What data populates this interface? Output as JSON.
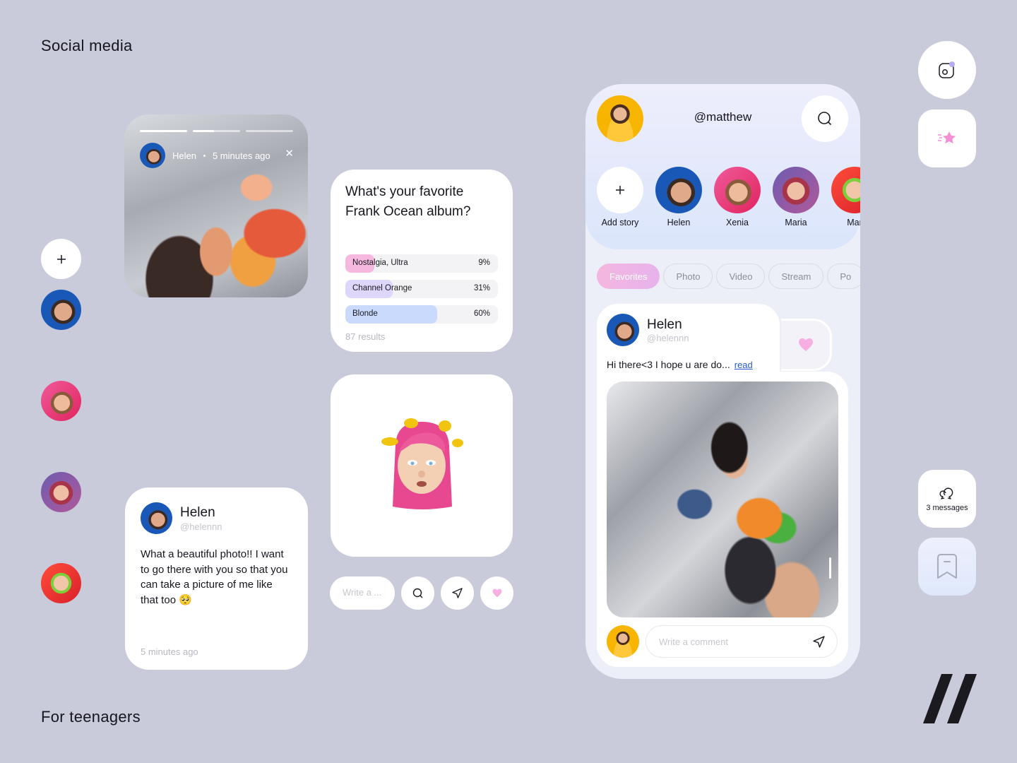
{
  "page": {
    "title": "Social media",
    "subtitle": "For teenagers"
  },
  "colors": {
    "background": "#c9cbdb",
    "accent_pink": "#f7aee0",
    "accent_lilac": "#ded6fb",
    "accent_blue": "#c9dafc",
    "link_blue": "#2a5bd0",
    "notification_dot": "#b9aaf5"
  },
  "story": {
    "user": "Helen",
    "time": "5 minutes ago",
    "segments": [
      {
        "progress": 1.0
      },
      {
        "progress": 0.45
      },
      {
        "progress": 0
      }
    ],
    "close_icon": "close-icon"
  },
  "poll": {
    "question": "What's your favorite Frank Ocean album?",
    "options": [
      {
        "label": "Nostalgia, Ultra",
        "percent_label": "9%",
        "percent": 9,
        "color": "#f7b8df"
      },
      {
        "label": "Channel Orange",
        "percent_label": "31%",
        "percent": 31,
        "color": "#ded6fb"
      },
      {
        "label": "Blonde",
        "percent_label": "60%",
        "percent": 60,
        "color": "#c9dafc"
      }
    ],
    "results": "87 results"
  },
  "memoji": {
    "description": "pink-haired memoji with yellow birds"
  },
  "compose": {
    "placeholder": "Write a ...",
    "buttons": [
      "search-icon",
      "send-icon",
      "heart-icon"
    ]
  },
  "comment": {
    "name": "Helen",
    "handle": "@helennn",
    "text": "What a beautiful photo!! I want to go there with you so that you can take a picture of me like that too 🥺",
    "time": "5 minutes ago"
  },
  "left_rail": {
    "add_icon": "plus-icon",
    "avatars": [
      "Helen",
      "Xenia",
      "Maria",
      "Mar"
    ]
  },
  "phone": {
    "handle": "@matthew",
    "stories": [
      {
        "label": "Add story"
      },
      {
        "label": "Helen"
      },
      {
        "label": "Xenia"
      },
      {
        "label": "Maria"
      },
      {
        "label": "Mar"
      }
    ],
    "tabs": [
      {
        "label": "Favorites",
        "active": true
      },
      {
        "label": "Photo",
        "active": false
      },
      {
        "label": "Video",
        "active": false
      },
      {
        "label": "Stream",
        "active": false
      },
      {
        "label": "Po",
        "active": false
      }
    ],
    "post": {
      "name": "Helen",
      "handle": "@helennn",
      "text": "Hi there<3 I hope u are do...",
      "read_link": "read"
    },
    "comment_placeholder": "Write a comment"
  },
  "right_rail": {
    "messages_label": "3 messages"
  }
}
